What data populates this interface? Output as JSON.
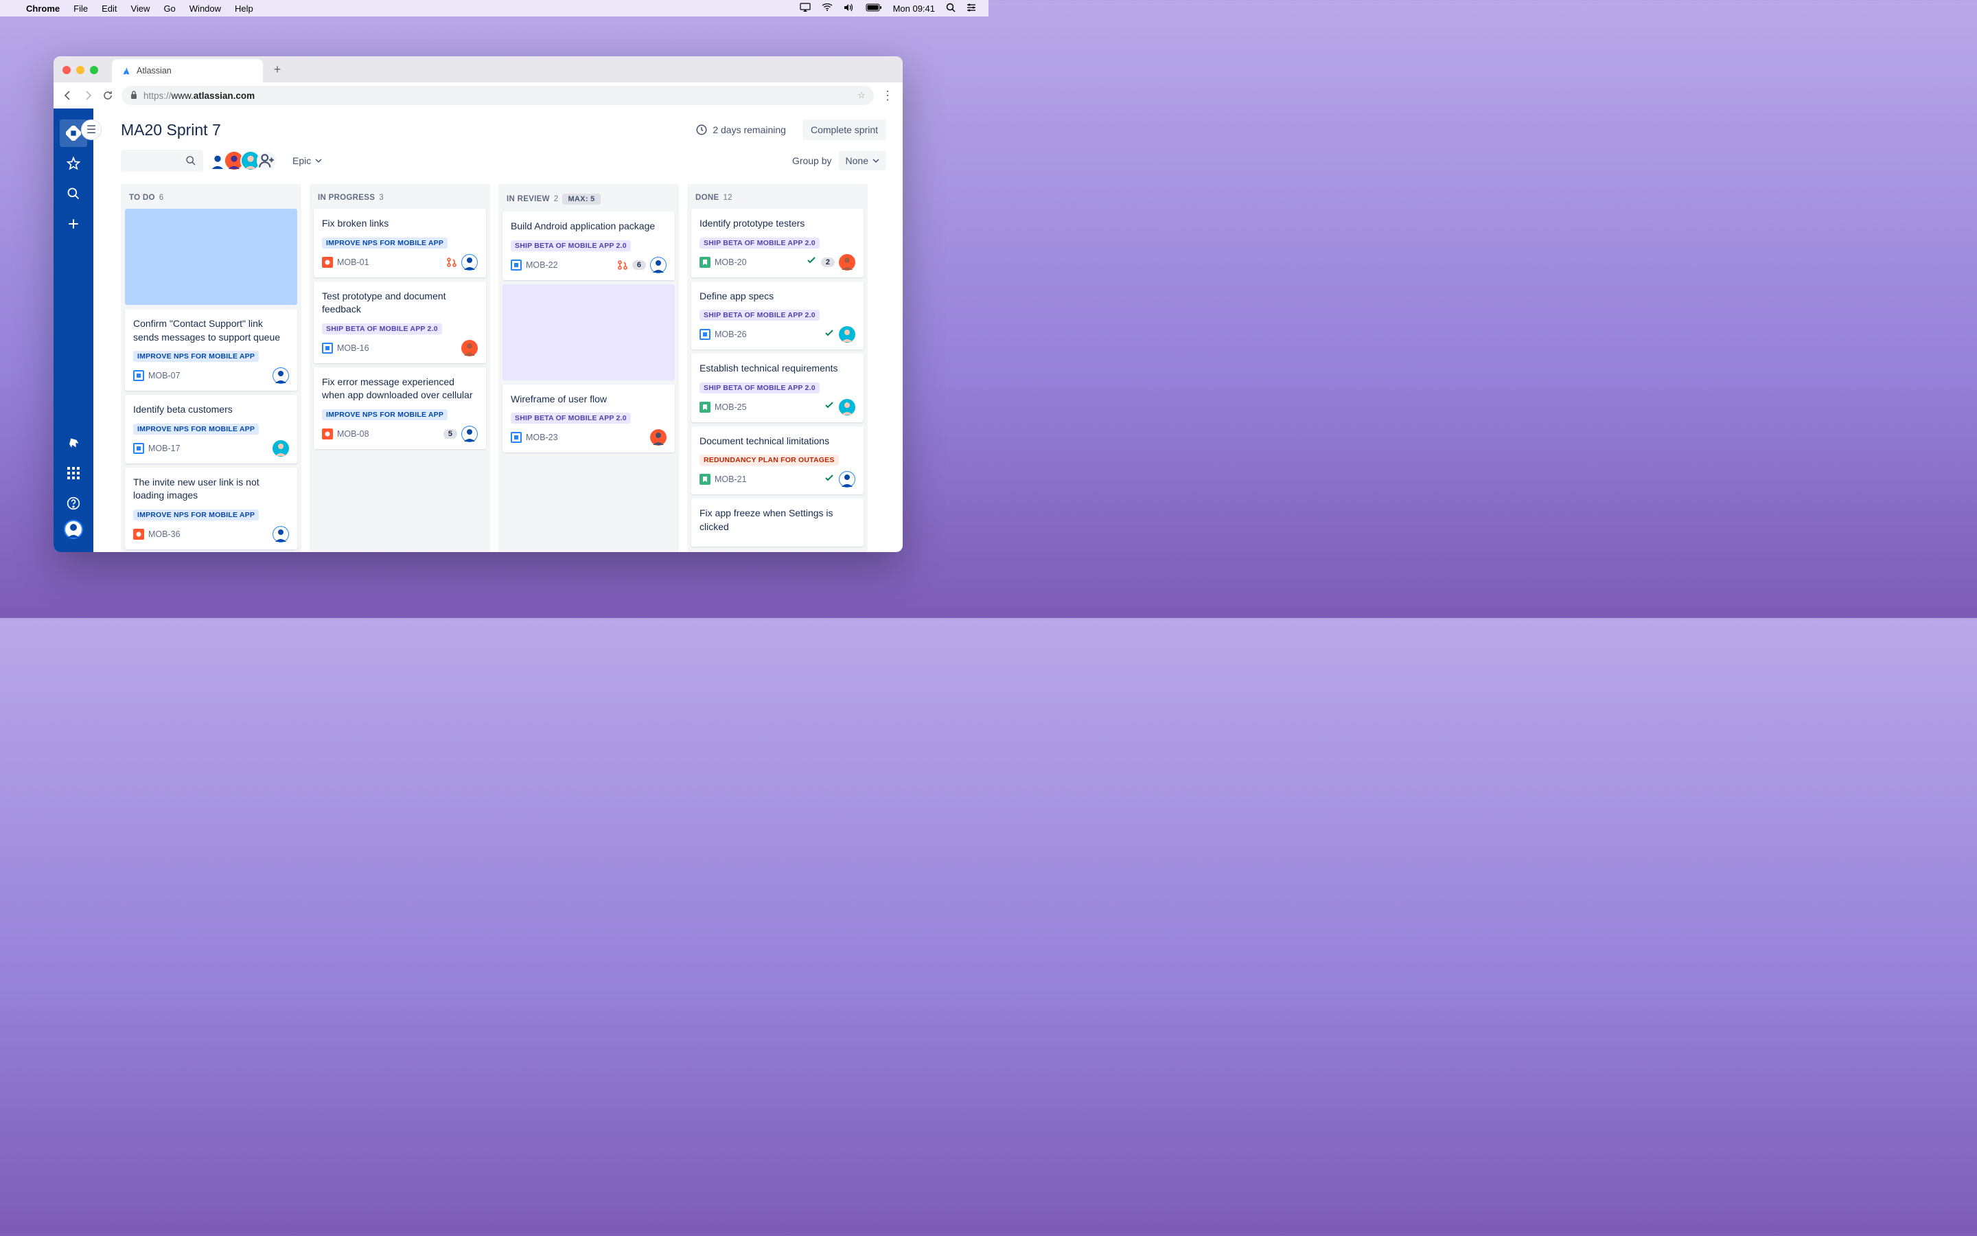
{
  "menubar": {
    "app": "Chrome",
    "items": [
      "File",
      "Edit",
      "View",
      "Go",
      "Window",
      "Help"
    ],
    "time": "Mon 09:41"
  },
  "tab": {
    "title": "Atlassian"
  },
  "url": {
    "prefix": "https://",
    "host": "www.",
    "domain": "atlassian.com"
  },
  "board": {
    "title": "MA20 Sprint 7",
    "remaining": "2 days remaining",
    "complete": "Complete sprint",
    "epic_label": "Epic",
    "groupby_label": "Group by",
    "groupby_value": "None"
  },
  "columns": [
    {
      "name": "TO DO",
      "count": "6"
    },
    {
      "name": "IN PROGRESS",
      "count": "3"
    },
    {
      "name": "IN REVIEW",
      "count": "2",
      "max": "MAX: 5"
    },
    {
      "name": "DONE",
      "count": "12"
    }
  ],
  "epics": {
    "nps": "IMPROVE NPS FOR MOBILE APP",
    "beta": "SHIP BETA OF MOBILE APP 2.0",
    "redund": "REDUNDANCY PLAN FOR OUTAGES"
  },
  "cards": {
    "todo": [
      {
        "title": "Confirm \"Contact Support\" link sends messages to support queue",
        "epic": "nps",
        "key": "MOB-07",
        "type": "task-outline",
        "assignee": "blue"
      },
      {
        "title": "Identify beta customers",
        "epic": "nps",
        "key": "MOB-17",
        "type": "task-outline",
        "assignee": "teal"
      },
      {
        "title": "The invite new user link is not loading images",
        "epic": "nps",
        "key": "MOB-36",
        "type": "bug",
        "assignee": "blue"
      }
    ],
    "inprogress": [
      {
        "title": "Fix broken links",
        "epic": "nps",
        "key": "MOB-01",
        "type": "bug",
        "assignee": "blue",
        "pr": true
      },
      {
        "title": "Test prototype and document feedback",
        "epic": "beta",
        "key": "MOB-16",
        "type": "task-outline",
        "assignee": "orange"
      },
      {
        "title": "Fix error message experienced when app downloaded over cellular",
        "epic": "nps",
        "key": "MOB-08",
        "type": "bug",
        "assignee": "blue",
        "extra": "5"
      }
    ],
    "inreview": [
      {
        "title": "Build Android application package",
        "epic": "beta",
        "key": "MOB-22",
        "type": "task-outline",
        "assignee": "blue",
        "pr": true,
        "extra": "6"
      },
      {
        "title": "Wireframe of user flow",
        "epic": "beta",
        "key": "MOB-23",
        "type": "task-outline",
        "assignee": "orange-dark"
      }
    ],
    "done": [
      {
        "title": "Identify prototype testers",
        "epic": "beta",
        "key": "MOB-20",
        "type": "story",
        "assignee": "orange",
        "done": true,
        "extra": "2"
      },
      {
        "title": "Define app specs",
        "epic": "beta",
        "key": "MOB-26",
        "type": "task-outline",
        "assignee": "teal",
        "done": true
      },
      {
        "title": "Establish technical requirements",
        "epic": "beta",
        "key": "MOB-25",
        "type": "story",
        "assignee": "teal",
        "done": true
      },
      {
        "title": "Document technical limitations",
        "epic": "redund",
        "key": "MOB-21",
        "type": "story",
        "assignee": "blue",
        "done": true
      },
      {
        "title": "Fix app freeze when Settings is clicked",
        "epic": "",
        "key": "",
        "type": "",
        "assignee": ""
      }
    ]
  }
}
